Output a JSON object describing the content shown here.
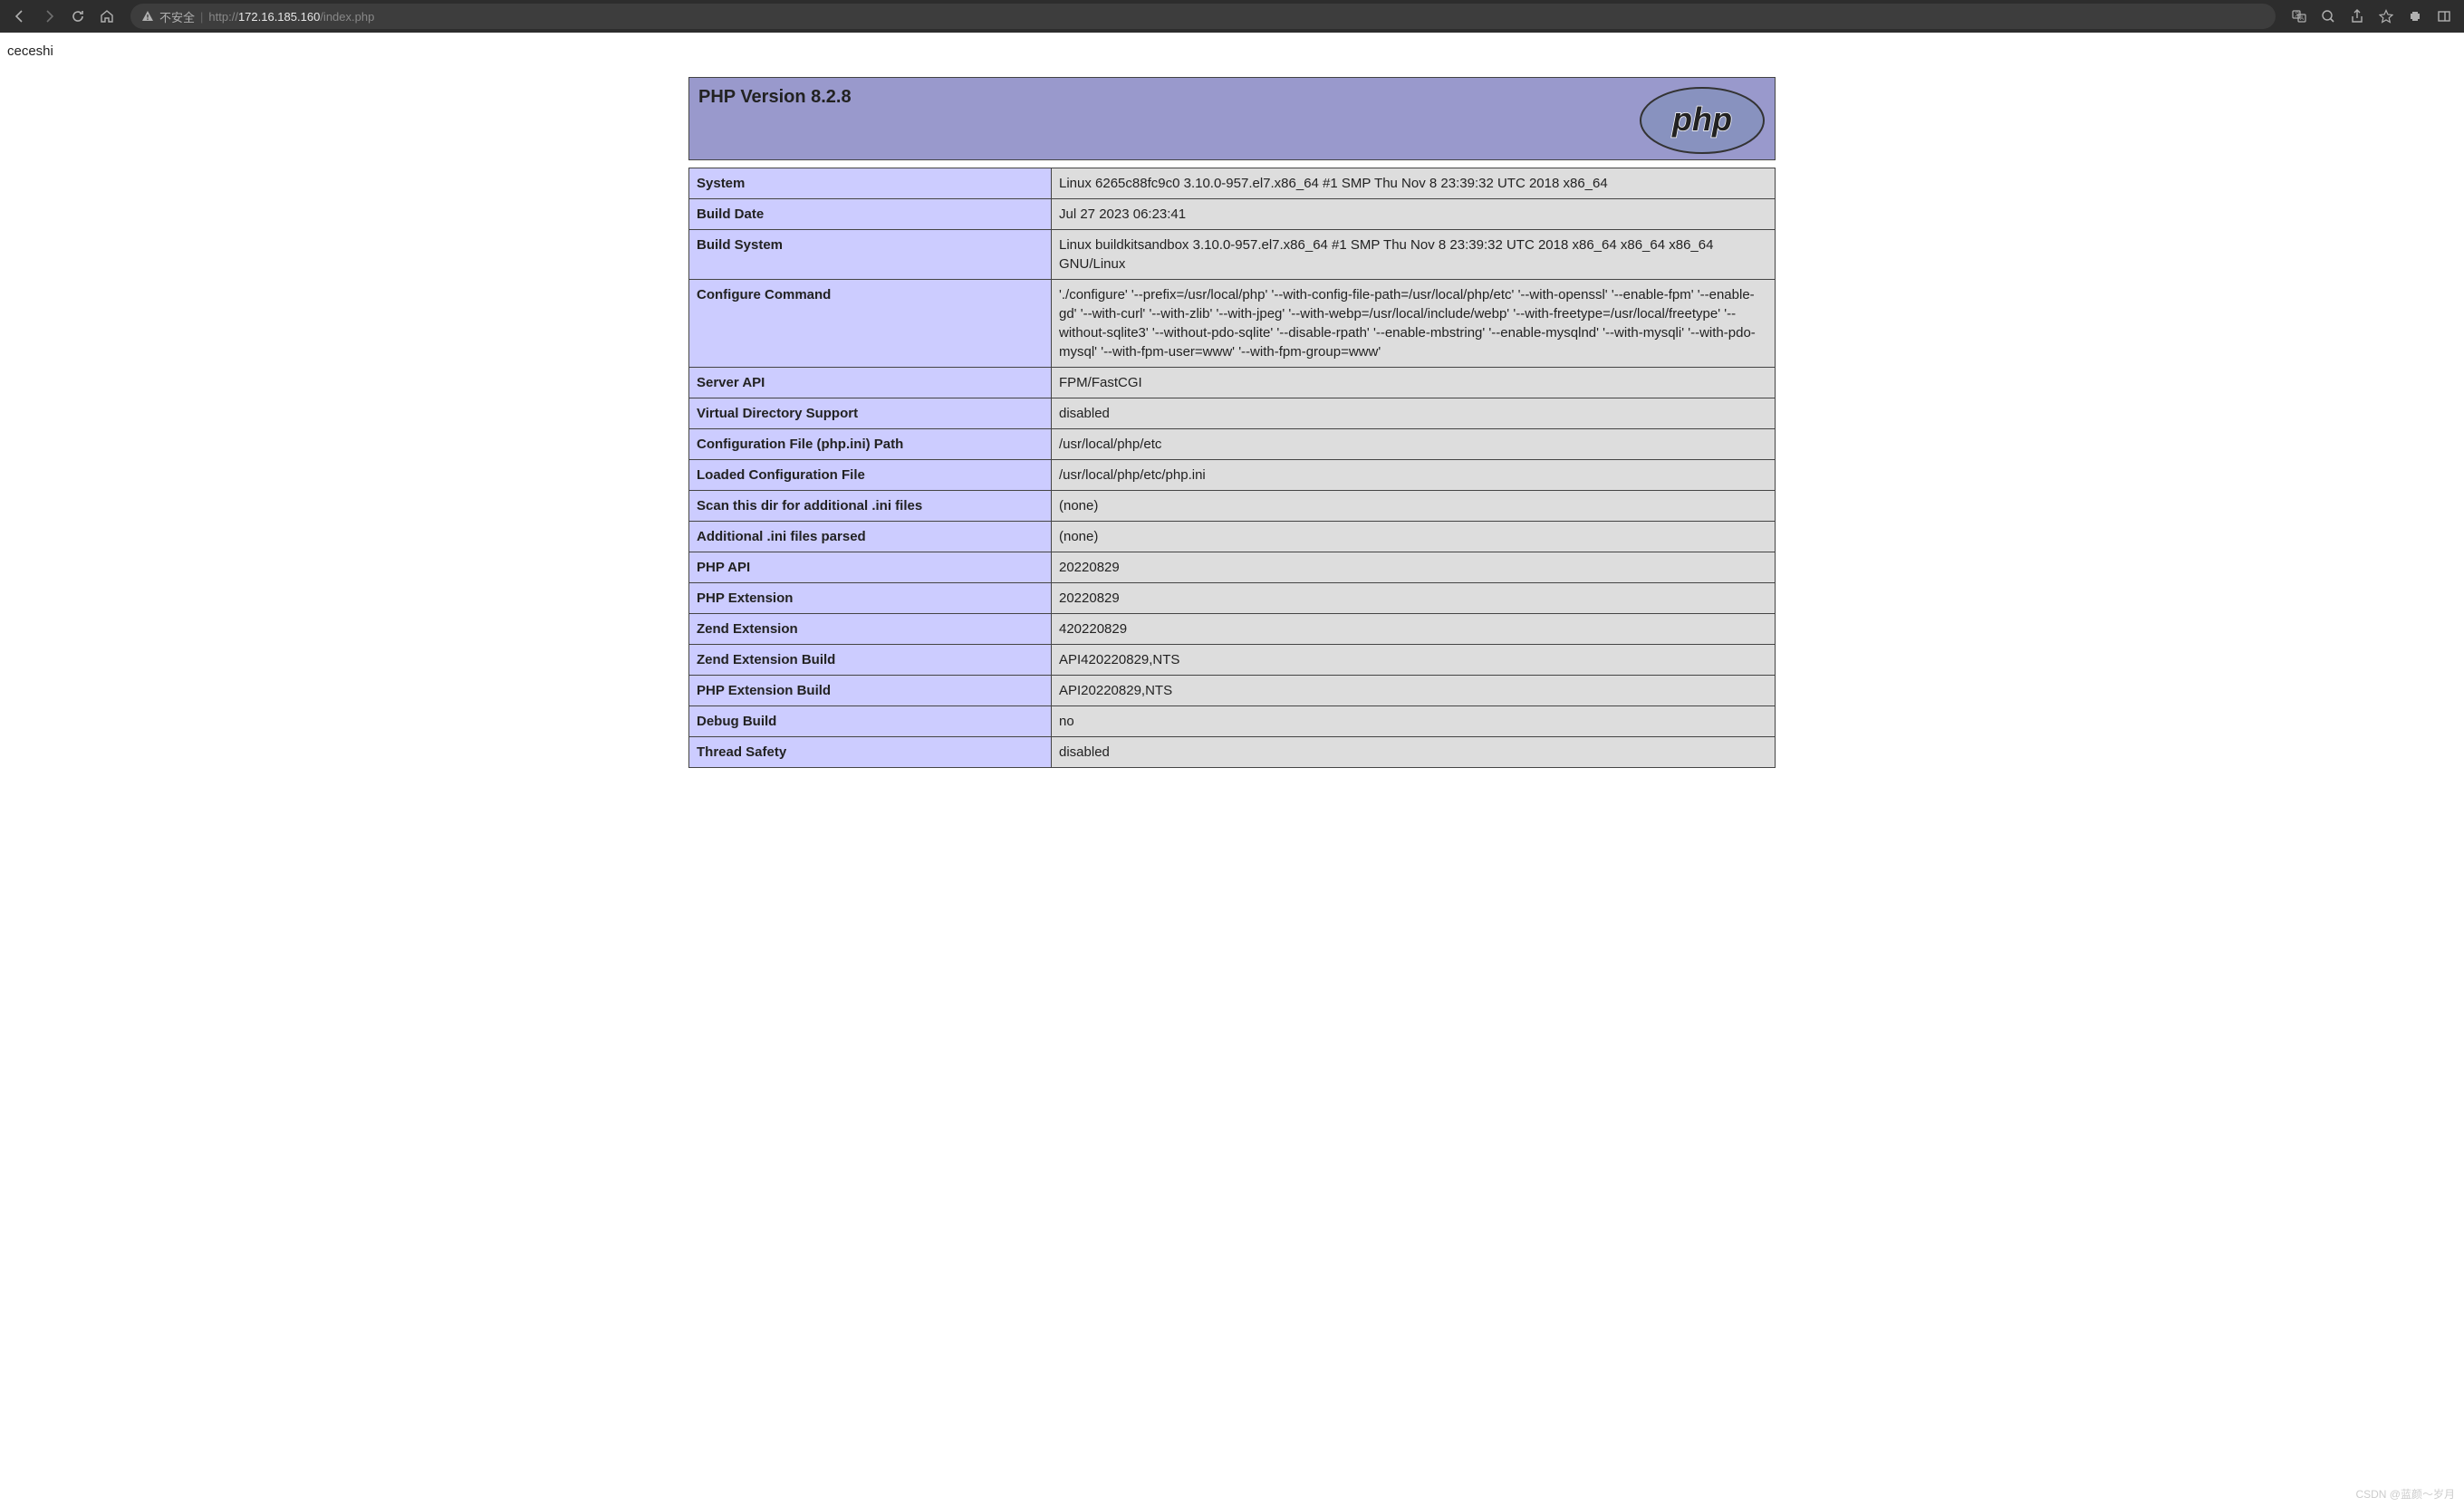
{
  "browser": {
    "insecure_label": "不安全",
    "url_scheme": "http://",
    "url_host": "172.16.185.160",
    "url_path": "/index.php"
  },
  "page": {
    "test_text": "ceceshi",
    "php_version_title": "PHP Version 8.2.8",
    "logo_text": "php"
  },
  "info_rows": [
    {
      "label": "System",
      "value": "Linux 6265c88fc9c0 3.10.0-957.el7.x86_64 #1 SMP Thu Nov 8 23:39:32 UTC 2018 x86_64"
    },
    {
      "label": "Build Date",
      "value": "Jul 27 2023 06:23:41"
    },
    {
      "label": "Build System",
      "value": "Linux buildkitsandbox 3.10.0-957.el7.x86_64 #1 SMP Thu Nov 8 23:39:32 UTC 2018 x86_64 x86_64 x86_64 GNU/Linux"
    },
    {
      "label": "Configure Command",
      "value": "'./configure' '--prefix=/usr/local/php' '--with-config-file-path=/usr/local/php/etc' '--with-openssl' '--enable-fpm' '--enable-gd' '--with-curl' '--with-zlib' '--with-jpeg' '--with-webp=/usr/local/include/webp' '--with-freetype=/usr/local/freetype' '--without-sqlite3' '--without-pdo-sqlite' '--disable-rpath' '--enable-mbstring' '--enable-mysqlnd' '--with-mysqli' '--with-pdo-mysql' '--with-fpm-user=www' '--with-fpm-group=www'"
    },
    {
      "label": "Server API",
      "value": "FPM/FastCGI"
    },
    {
      "label": "Virtual Directory Support",
      "value": "disabled"
    },
    {
      "label": "Configuration File (php.ini) Path",
      "value": "/usr/local/php/etc"
    },
    {
      "label": "Loaded Configuration File",
      "value": "/usr/local/php/etc/php.ini"
    },
    {
      "label": "Scan this dir for additional .ini files",
      "value": "(none)"
    },
    {
      "label": "Additional .ini files parsed",
      "value": "(none)"
    },
    {
      "label": "PHP API",
      "value": "20220829"
    },
    {
      "label": "PHP Extension",
      "value": "20220829"
    },
    {
      "label": "Zend Extension",
      "value": "420220829"
    },
    {
      "label": "Zend Extension Build",
      "value": "API420220829,NTS"
    },
    {
      "label": "PHP Extension Build",
      "value": "API20220829,NTS"
    },
    {
      "label": "Debug Build",
      "value": "no"
    },
    {
      "label": "Thread Safety",
      "value": "disabled"
    }
  ],
  "watermark": "CSDN @蓝颜～岁月"
}
